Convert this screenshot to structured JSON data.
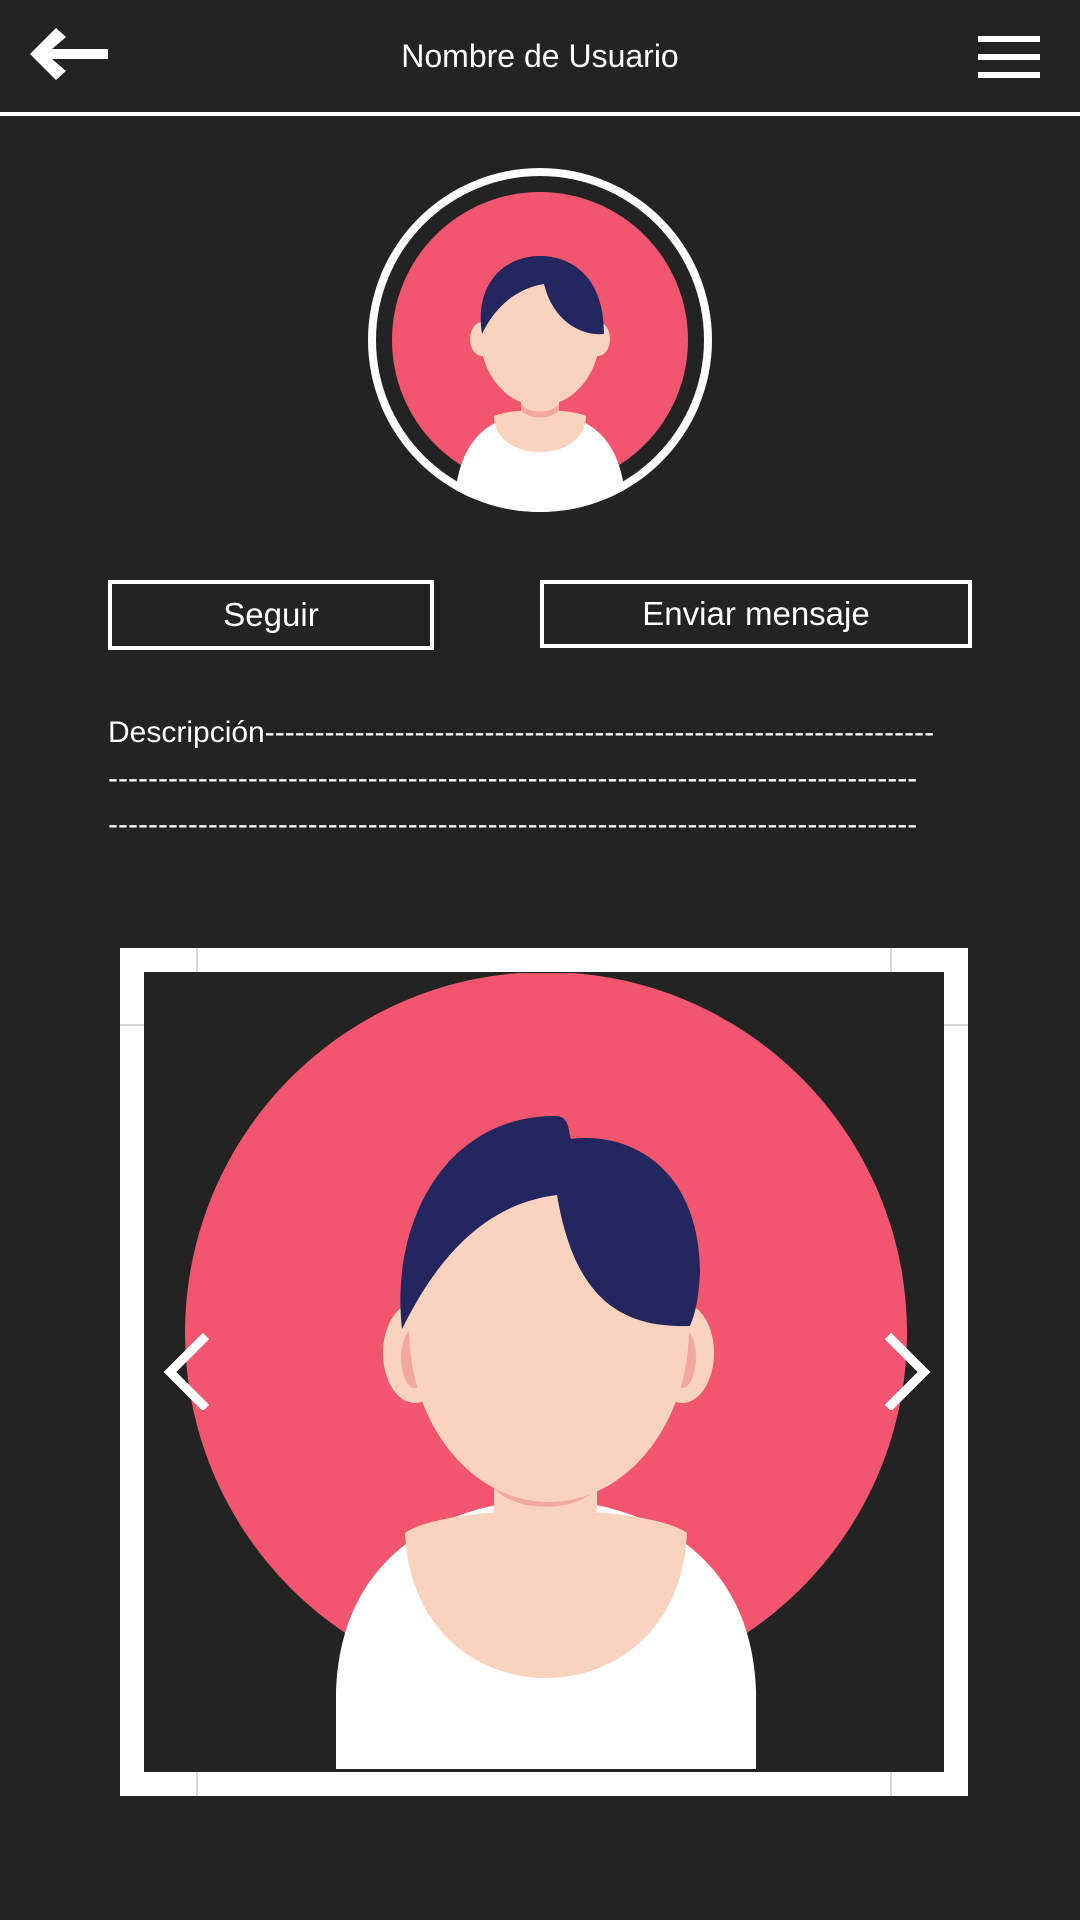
{
  "header": {
    "title": "Nombre de Usuario",
    "back_icon": "arrow-left-icon",
    "menu_icon": "hamburger-menu-icon"
  },
  "profile": {
    "avatar_icon": "user-avatar-illustration",
    "follow_label": "Seguir",
    "message_label": "Enviar mensaje"
  },
  "description": {
    "lines": [
      "Descripción-------------------------------------------------------------------",
      "---------------------------------------------------------------------------------",
      "---------------------------------------------------------------------------------"
    ]
  },
  "gallery": {
    "image_icon": "user-avatar-illustration",
    "prev_icon": "chevron-left-icon",
    "next_icon": "chevron-right-icon"
  },
  "colors": {
    "background": "#232323",
    "foreground": "#ffffff",
    "avatar_circle": "#f1566e",
    "hair": "#23265f",
    "skin": "#fad3bf",
    "skin_shadow": "#f3a89e"
  }
}
